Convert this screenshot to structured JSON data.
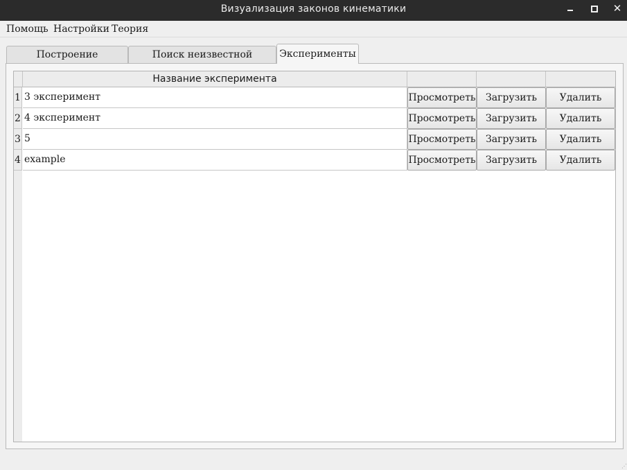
{
  "window": {
    "title": "Визуализация законов кинематики",
    "close_glyph": "✕"
  },
  "menu": {
    "help": "Помощь",
    "settings": "Настройки",
    "theory": "Теория"
  },
  "tabs": [
    {
      "label": "Построение траектории",
      "active": false
    },
    {
      "label": "Поиск неизвестной величины",
      "active": false
    },
    {
      "label": "Эксперименты",
      "active": true
    }
  ],
  "table": {
    "headers": [
      "Название эксперимента",
      "",
      "",
      ""
    ],
    "rows": [
      {
        "num": "1",
        "name": "3 эксперимент",
        "view": "Просмотреть",
        "load": "Загрузить",
        "delete": "Удалить"
      },
      {
        "num": "2",
        "name": "4 эксперимент",
        "view": "Просмотреть",
        "load": "Загрузить",
        "delete": "Удалить"
      },
      {
        "num": "3",
        "name": "5",
        "view": "Просмотреть",
        "load": "Загрузить",
        "delete": "Удалить"
      },
      {
        "num": "4",
        "name": "example",
        "view": "Просмотреть",
        "load": "Загрузить",
        "delete": "Удалить"
      }
    ]
  },
  "icons": {
    "minimize": "minimize-icon",
    "maximize": "maximize-icon",
    "close": "close-icon"
  }
}
